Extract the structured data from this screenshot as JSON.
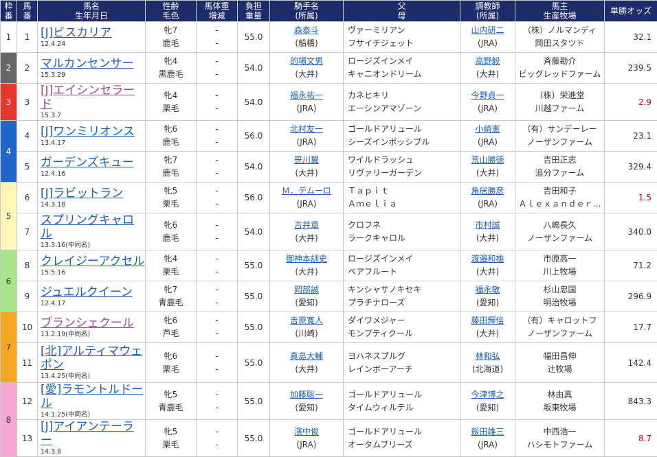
{
  "headers": {
    "waku": [
      "枠",
      "番"
    ],
    "umaban": [
      "馬",
      "番"
    ],
    "horse": [
      "馬名",
      "生年月日"
    ],
    "sexage": [
      "性齢",
      "毛色"
    ],
    "bodyweight": [
      "馬体重",
      "増減"
    ],
    "kinryo": [
      "負担",
      "重量"
    ],
    "jockey": [
      "騎手名",
      "(所属)"
    ],
    "parents": [
      "父",
      "母"
    ],
    "trainer": [
      "調教師",
      "(所属)"
    ],
    "owner": [
      "馬主",
      "生産牧場"
    ],
    "odds": "単勝オッズ"
  },
  "colors": {
    "header_bg": "#1f2c6b",
    "waku1": "#ffffff",
    "waku2": "#666666",
    "waku3": "#e8382c",
    "waku4": "#1e66c8",
    "waku5": "#fff7b8",
    "waku6": "#a9e38a",
    "waku7": "#f5a623",
    "waku8": "#f4a7d0",
    "link": "#1a5fb4",
    "female_link": "#a24a9e",
    "fav_odds": "#d9001b"
  },
  "rows": [
    {
      "waku": "1",
      "num": "1",
      "name": "[J]ビスカリア",
      "female": false,
      "date": "12.4.24",
      "sex": "牝7",
      "coat": "鹿毛",
      "wt1": "-",
      "wt2": "-",
      "kinryo": "55.0",
      "jockey": "森泰斗",
      "jaff": "(船橋)",
      "sire": "ヴァーミリアン",
      "dam": "フサイチジェット",
      "trainer": "山内研二",
      "taff": "(JRA)",
      "owner": "（株）ノルマンディ",
      "farm": "岡田スタツド",
      "odds": "32.1",
      "fav": false
    },
    {
      "waku": "2",
      "num": "2",
      "name": "マルカンセンサー",
      "female": false,
      "date": "15.3.29",
      "sex": "牝4",
      "coat": "黒鹿毛",
      "wt1": "-",
      "wt2": "-",
      "kinryo": "54.0",
      "jockey": "的場文男",
      "jaff": "(大井)",
      "sire": "ロージズインメイ",
      "dam": "キャニオンドリーム",
      "trainer": "高野毅",
      "taff": "(大井)",
      "owner": "斉藤勘介",
      "farm": "ビッグレッドファーム",
      "odds": "239.5",
      "fav": false
    },
    {
      "waku": "3",
      "num": "3",
      "name": "[J]エイシンセラード",
      "female": true,
      "date": "15.3.7",
      "sex": "牝4",
      "coat": "栗毛",
      "wt1": "-",
      "wt2": "-",
      "kinryo": "54.0",
      "jockey": "福永祐一",
      "jaff": "(JRA)",
      "sire": "カネヒキリ",
      "dam": "エーシンアマゾーン",
      "trainer": "今野貞一",
      "taff": "(JRA)",
      "owner": "（株）栄進堂",
      "farm": "川越ファーム",
      "odds": "2.9",
      "fav": true
    },
    {
      "waku": "4",
      "num": "4",
      "name": "[J]ワンミリオンス",
      "female": false,
      "date": "13.4.17",
      "sex": "牝6",
      "coat": "鹿毛",
      "wt1": "-",
      "wt2": "-",
      "kinryo": "56.0",
      "jockey": "北村友一",
      "jaff": "(JRA)",
      "sire": "ゴールドアリュール",
      "dam": "シーズインポッシブル",
      "trainer": "小崎憲",
      "taff": "(JRA)",
      "owner": "（有）サンデーレー",
      "farm": "ノーザンファーム",
      "odds": "23.1",
      "fav": false
    },
    {
      "waku": "4",
      "num": "5",
      "name": "ガーデンズキュー",
      "female": false,
      "date": "12.4.16",
      "sex": "牝7",
      "coat": "鹿毛",
      "wt1": "-",
      "wt2": "-",
      "kinryo": "54.0",
      "jockey": "笹川翼",
      "jaff": "(大井)",
      "sire": "ワイルドラッシュ",
      "dam": "リヴァリーガーデン",
      "trainer": "荒山勝徳",
      "taff": "(大井)",
      "owner": "吉田正志",
      "farm": "追分ファーム",
      "odds": "329.4",
      "fav": false
    },
    {
      "waku": "5",
      "num": "6",
      "name": "[J]ラビットラン",
      "female": false,
      "date": "14.3.18",
      "sex": "牝5",
      "coat": "栗毛",
      "wt1": "-",
      "wt2": "-",
      "kinryo": "56.0",
      "jockey": "Ｍ．デムーロ",
      "jaff": "(JRA)",
      "sire": "Ｔａｐｉｔ",
      "dam": "Ａｍｅｌｉａ",
      "trainer": "角居勝彦",
      "taff": "(JRA)",
      "owner": "吉田和子",
      "farm": "Ａｌｅｘａｎｄｅｒ…",
      "odds": "1.5",
      "fav": true
    },
    {
      "waku": "5",
      "num": "7",
      "name": "スプリングキャロル",
      "female": false,
      "date": "13.3.16(中同名)",
      "sex": "牝6",
      "coat": "鹿毛",
      "wt1": "-",
      "wt2": "-",
      "kinryo": "54.0",
      "jockey": "吉井章",
      "jaff": "(大井)",
      "sire": "クロフネ",
      "dam": "ラークキャロル",
      "trainer": "市村誠",
      "taff": "(大井)",
      "owner": "八嶋長久",
      "farm": "ノーザンファーム",
      "odds": "340.0",
      "fav": false
    },
    {
      "waku": "6",
      "num": "8",
      "name": "クレイジーアクセル",
      "female": false,
      "date": "15.5.16",
      "sex": "牝4",
      "coat": "栗毛",
      "wt1": "-",
      "wt2": "-",
      "kinryo": "55.0",
      "jockey": "御神本訓史",
      "jaff": "(大井)",
      "sire": "ロージズインメイ",
      "dam": "ベアフルート",
      "trainer": "渡邉和雄",
      "taff": "(大井)",
      "owner": "市原高一",
      "farm": "川上牧場",
      "odds": "71.2",
      "fav": false
    },
    {
      "waku": "6",
      "num": "9",
      "name": "ジュエルクイーン",
      "female": false,
      "date": "12.4.17",
      "sex": "牝7",
      "coat": "青鹿毛",
      "wt1": "-",
      "wt2": "-",
      "kinryo": "55.0",
      "jockey": "岡部誠",
      "jaff": "(愛知)",
      "sire": "キンシャサノキセキ",
      "dam": "プラチナローズ",
      "trainer": "福永敏",
      "taff": "(愛知)",
      "owner": "杉山忠国",
      "farm": "明治牧場",
      "odds": "296.9",
      "fav": false
    },
    {
      "waku": "7",
      "num": "10",
      "name": "ブランシェクール",
      "female": true,
      "date": "13.2.19(中同名)",
      "sex": "牝6",
      "coat": "芦毛",
      "wt1": "-",
      "wt2": "-",
      "kinryo": "55.0",
      "jockey": "吉原寛人",
      "jaff": "(川崎)",
      "sire": "ダイワメジャー",
      "dam": "モンプティクール",
      "trainer": "藤田輝信",
      "taff": "(大井)",
      "owner": "（有）キャロットフ",
      "farm": "ノーザンファーム",
      "odds": "17.7",
      "fav": false
    },
    {
      "waku": "7",
      "num": "11",
      "name": "[北]アルティマウェポン",
      "female": false,
      "date": "13.4.25(中同名)",
      "sex": "牝6",
      "coat": "栗毛",
      "wt1": "-",
      "wt2": "-",
      "kinryo": "55.0",
      "jockey": "真島大輔",
      "jaff": "(大井)",
      "sire": "ヨハネスブルグ",
      "dam": "レインボーアーチ",
      "trainer": "林和弘",
      "taff": "(北海道)",
      "owner": "幅田昌伸",
      "farm": "辻牧場",
      "odds": "142.4",
      "fav": false
    },
    {
      "waku": "8",
      "num": "12",
      "name": "[愛]ラモントルドール",
      "female": false,
      "date": "14.1.25(中同名)",
      "sex": "牝5",
      "coat": "青鹿毛",
      "wt1": "-",
      "wt2": "-",
      "kinryo": "55.0",
      "jockey": "加藤聡一",
      "jaff": "(愛知)",
      "sire": "ゴールドアリュール",
      "dam": "タイムウィルテル",
      "trainer": "今津博之",
      "taff": "(愛知)",
      "owner": "林由真",
      "farm": "坂東牧場",
      "odds": "843.3",
      "fav": false
    },
    {
      "waku": "8",
      "num": "13",
      "name": "[J]アイアンテーラー",
      "female": false,
      "date": "14.3.8",
      "sex": "牝5",
      "coat": "栗毛",
      "wt1": "-",
      "wt2": "-",
      "kinryo": "55.0",
      "jockey": "濱中俊",
      "jaff": "(JRA)",
      "sire": "ゴールドアリュール",
      "dam": "オータムブリーズ",
      "trainer": "飯田雄三",
      "taff": "(JRA)",
      "owner": "中西浩一",
      "farm": "ハシモトファーム",
      "odds": "8.7",
      "fav": true
    }
  ]
}
